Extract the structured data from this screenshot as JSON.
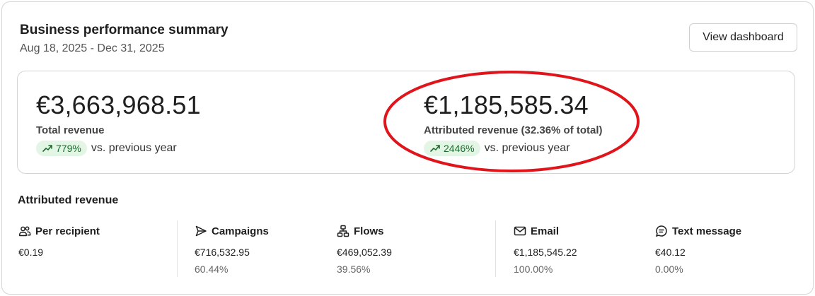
{
  "header": {
    "title": "Business performance summary",
    "date_range": "Aug 18, 2025 - Dec 31, 2025",
    "view_button": "View dashboard"
  },
  "summary": {
    "total": {
      "amount": "€3,663,968.51",
      "label": "Total revenue",
      "change": "779%",
      "change_text": "vs. previous year"
    },
    "attributed": {
      "amount": "€1,185,585.34",
      "label": "Attributed revenue (32.36% of total)",
      "change": "2446%",
      "change_text": "vs. previous year"
    }
  },
  "annotation": {
    "color": "#e0151c"
  },
  "breakdown": {
    "title": "Attributed revenue",
    "per_recipient": {
      "label": "Per recipient",
      "value": "€0.19",
      "icon": "people-icon"
    },
    "campaigns": {
      "label": "Campaigns",
      "value": "€716,532.95",
      "pct": "60.44%",
      "icon": "send-icon"
    },
    "flows": {
      "label": "Flows",
      "value": "€469,052.39",
      "pct": "39.56%",
      "icon": "flow-icon"
    },
    "email": {
      "label": "Email",
      "value": "€1,185,545.22",
      "pct": "100.00%",
      "icon": "mail-icon"
    },
    "text_message": {
      "label": "Text message",
      "value": "€40.12",
      "pct": "0.00%",
      "icon": "chat-icon"
    }
  },
  "colors": {
    "badge_bg": "#e3f6e5",
    "badge_text": "#1c6b2c"
  }
}
